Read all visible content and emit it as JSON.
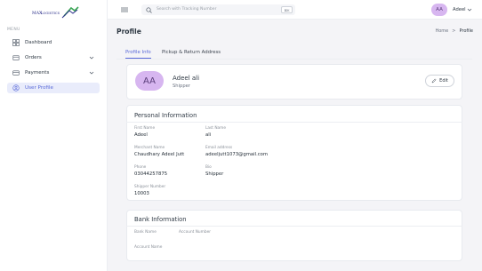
{
  "brand": {
    "name": "MAX",
    "sub": "LOGISTICS"
  },
  "sidebar": {
    "menu_label": "MENU",
    "items": [
      {
        "label": "Dashboard",
        "icon": "dashboard-icon"
      },
      {
        "label": "Orders",
        "icon": "orders-icon",
        "chevron": true
      },
      {
        "label": "Payments",
        "icon": "payments-icon",
        "chevron": true
      },
      {
        "label": "User Profile",
        "icon": "user-icon",
        "active": true
      }
    ]
  },
  "topbar": {
    "search_placeholder": "Search with Tracking Number",
    "shortcut": "⌘K",
    "avatar_initials": "AA",
    "user_name": "Adeel"
  },
  "page": {
    "title": "Profile",
    "breadcrumb": {
      "home": "Home",
      "sep": ">",
      "current": "Profile"
    }
  },
  "tabs": [
    "Profile Info",
    "Pickup & Return Address"
  ],
  "profile": {
    "initials": "AA",
    "name": "Adeel ali",
    "role": "Shipper",
    "edit_label": "Edit"
  },
  "personal": {
    "title": "Personal Information",
    "fields": [
      {
        "label": "First Name",
        "value": "Adeel"
      },
      {
        "label": "Last Name",
        "value": "ali"
      },
      {
        "label": "Merchant Name",
        "value": "Chaudhary Adeel Jutt"
      },
      {
        "label": "Email address",
        "value": "adeeljutt1073@gmail.com"
      },
      {
        "label": "Phone",
        "value": "03044257875"
      },
      {
        "label": "Bio",
        "value": "Shipper"
      },
      {
        "label": "Shipper Number",
        "value": "10003"
      }
    ]
  },
  "bank": {
    "title": "Bank Information",
    "fields": [
      {
        "label": "Bank Name",
        "value": ""
      },
      {
        "label": "Account Number",
        "value": ""
      },
      {
        "label": "Account Name",
        "value": ""
      }
    ]
  },
  "colors": {
    "accent": "#5868d8",
    "avatar": "#d7b6f0",
    "logo_green": "#3aa655"
  }
}
